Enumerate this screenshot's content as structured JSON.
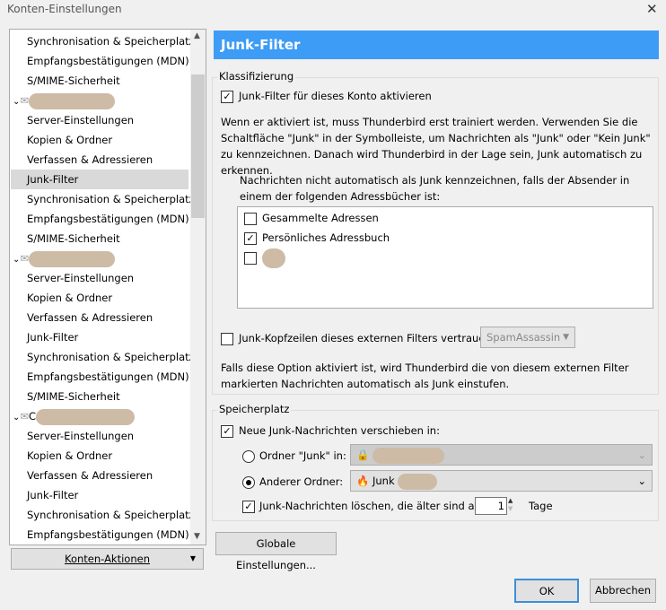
{
  "window": {
    "title": "Konten-Einstellungen",
    "close": "✕"
  },
  "sidebar": {
    "items": [
      {
        "label": "Synchronisation & Speicherplatz"
      },
      {
        "label": "Empfangsbestätigungen (MDN)"
      },
      {
        "label": "S/MIME-Sicherheit"
      },
      {
        "label": "",
        "account": true
      },
      {
        "label": "Server-Einstellungen"
      },
      {
        "label": "Kopien & Ordner"
      },
      {
        "label": "Verfassen & Adressieren"
      },
      {
        "label": "Junk-Filter",
        "selected": true
      },
      {
        "label": "Synchronisation & Speicherplatz"
      },
      {
        "label": "Empfangsbestätigungen (MDN)"
      },
      {
        "label": "S/MIME-Sicherheit"
      },
      {
        "label": "",
        "account": true
      },
      {
        "label": "Server-Einstellungen"
      },
      {
        "label": "Kopien & Ordner"
      },
      {
        "label": "Verfassen & Adressieren"
      },
      {
        "label": "Junk-Filter"
      },
      {
        "label": "Synchronisation & Speicherplatz"
      },
      {
        "label": "Empfangsbestätigungen (MDN)"
      },
      {
        "label": "S/MIME-Sicherheit"
      },
      {
        "label": "C",
        "account": true
      },
      {
        "label": "Server-Einstellungen"
      },
      {
        "label": "Kopien & Ordner"
      },
      {
        "label": "Verfassen & Adressieren"
      },
      {
        "label": "Junk-Filter"
      },
      {
        "label": "Synchronisation & Speicherplatz"
      },
      {
        "label": "Empfangsbestätigungen (MDN)"
      }
    ],
    "account_actions": "Konten-Aktionen"
  },
  "main": {
    "header": "Junk-Filter",
    "classification": {
      "legend": "Klassifizierung",
      "enable_label": "Junk-Filter für dieses Konto aktivieren",
      "enable_checked": true,
      "info": "Wenn er aktiviert ist, muss Thunderbird erst trainiert werden. Verwenden Sie die Schaltfläche \"Junk\" in der Symbolleiste, um Nachrichten als \"Junk\" oder \"Kein Junk\" zu kennzeichnen. Danach wird Thunderbird in der Lage sein, Junk automatisch zu erkennen.",
      "whitelist_label": "Nachrichten nicht automatisch als Junk kennzeichnen, falls der Absender in einem der folgenden Adressbücher ist:",
      "addressbooks": [
        {
          "label": "Gesammelte Adressen",
          "checked": false
        },
        {
          "label": "Persönliches Adressbuch",
          "checked": true
        },
        {
          "label": "",
          "checked": false
        }
      ],
      "trust_label": "Junk-Kopfzeilen dieses externen Filters vertrauen:",
      "trust_checked": false,
      "trust_select": "SpamAssassin",
      "trust_info": "Falls diese Option aktiviert ist, wird Thunderbird die von diesem externen Filter markierten Nachrichten automatisch als Junk einstufen."
    },
    "storage": {
      "legend": "Speicherplatz",
      "move_label": "Neue Junk-Nachrichten verschieben in:",
      "move_checked": true,
      "junk_folder_label": "Ordner \"Junk\" in:",
      "other_folder_label": "Anderer Ordner:",
      "other_folder_value": "Junk",
      "delete_label": "Junk-Nachrichten löschen, die älter sind als",
      "delete_checked": true,
      "days": "1",
      "days_unit": "Tage"
    },
    "global_button": "Globale Einstellungen..."
  },
  "footer": {
    "ok": "OK",
    "cancel": "Abbrechen"
  }
}
